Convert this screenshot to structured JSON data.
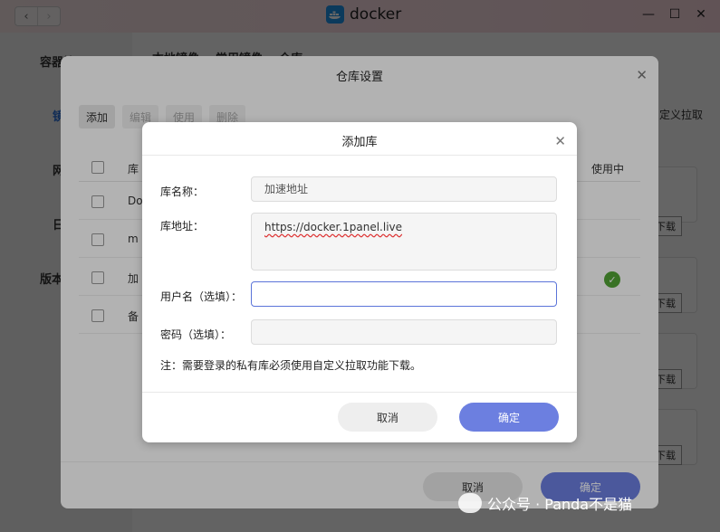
{
  "window": {
    "title": "docker",
    "nav_back": "‹",
    "nav_forward": "›",
    "minimize": "—",
    "maximize": "☐",
    "close": "✕"
  },
  "background_app": {
    "sidebar": [
      "容器管理",
      "镜",
      "网",
      "日",
      "版本"
    ],
    "tabs": [
      "本地镜像",
      "常用镜像",
      "仓库"
    ],
    "right_button": "定义拉取",
    "download_label": "下载"
  },
  "repo_settings_dialog": {
    "title": "仓库设置",
    "toolbar": {
      "add": "添加",
      "edit": "编辑",
      "use": "使用",
      "delete": "删除"
    },
    "columns": {
      "name": "库",
      "in_use": "使用中"
    },
    "rows": [
      "Do",
      "m",
      "加",
      "备"
    ],
    "in_use_row": 2,
    "cancel": "取消",
    "confirm": "确定"
  },
  "add_repo_dialog": {
    "title": "添加库",
    "fields": {
      "name_label": "库名称：",
      "name_value": "加速地址",
      "address_label": "库地址：",
      "address_value": "https://docker.1panel.live",
      "username_label": "用户名（选填）：",
      "username_value": "",
      "password_label": "密码（选填）：",
      "password_value": ""
    },
    "note": "注：需要登录的私有库必须使用自定义拉取功能下载。",
    "cancel": "取消",
    "confirm": "确定"
  },
  "watermark": "公众号 · Panda不是猫",
  "colors": {
    "primary": "#6c7fe0",
    "focus_border": "#5b74d9",
    "success": "#52a436"
  }
}
